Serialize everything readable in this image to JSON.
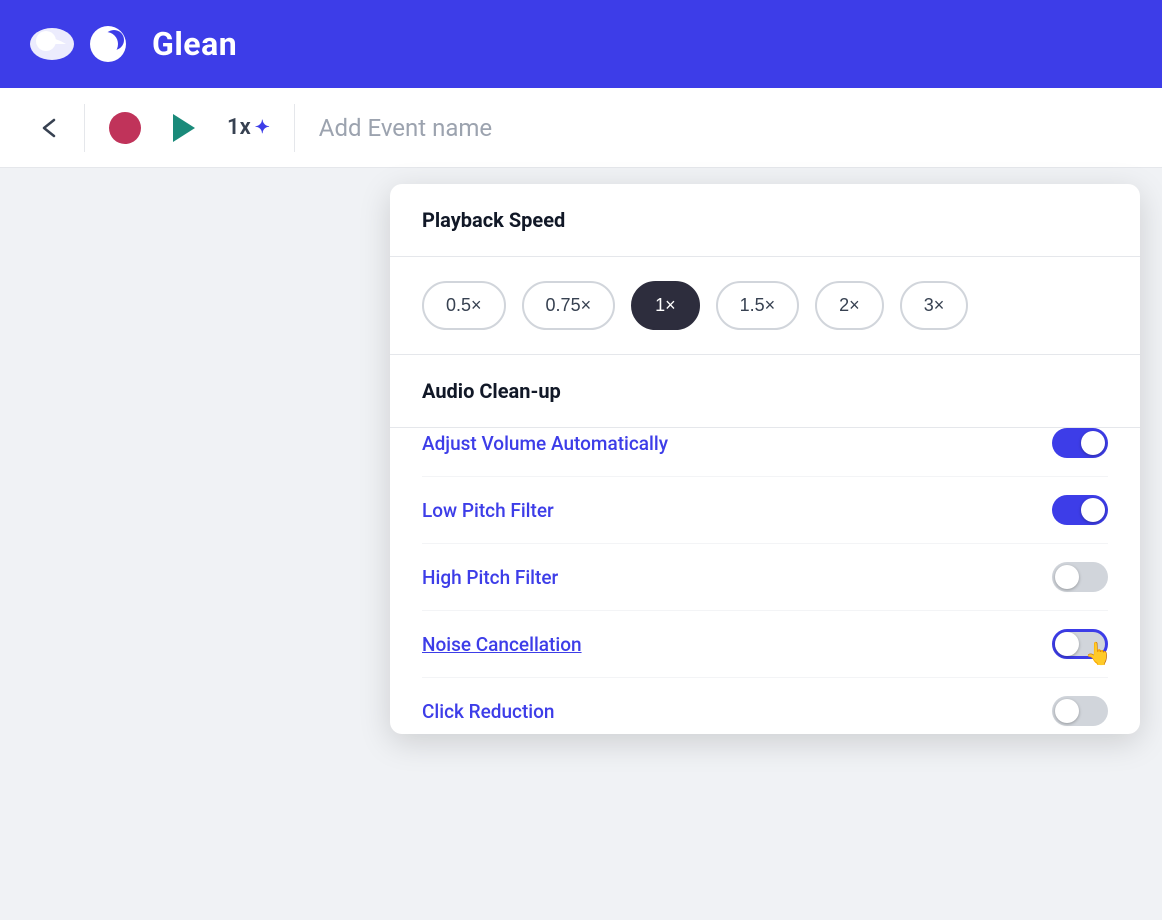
{
  "header": {
    "logo_text": "Glean",
    "bg_color": "#3d3de8"
  },
  "toolbar": {
    "speed_label": "1x",
    "event_placeholder": "Add Event name"
  },
  "dropdown": {
    "playback_section": {
      "title": "Playback Speed",
      "speeds": [
        "0.5x",
        "0.75x",
        "1x",
        "1.5x",
        "2x",
        "3x"
      ],
      "active_speed": "1x"
    },
    "audio_section": {
      "title": "Audio Clean-up",
      "toggles": [
        {
          "label": "Adjust Volume Automatically",
          "state": "on",
          "underline": false
        },
        {
          "label": "Low Pitch Filter",
          "state": "on",
          "underline": false
        },
        {
          "label": "High Pitch Filter",
          "state": "off",
          "underline": false
        },
        {
          "label": "Noise Cancellation",
          "state": "focused",
          "underline": true
        },
        {
          "label": "Click Reduction",
          "state": "off",
          "underline": false
        }
      ]
    }
  }
}
